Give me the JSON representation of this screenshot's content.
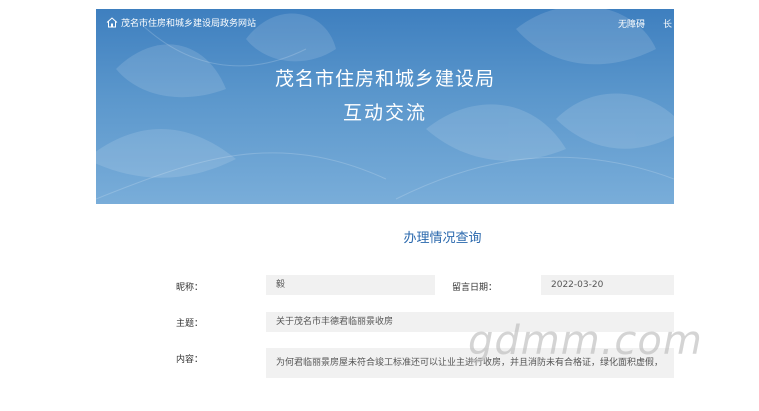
{
  "header": {
    "site_name": "茂名市住房和城乡建设局政务网站",
    "accessibility_link": "无障碍",
    "elder_link": "长",
    "title_line1": "茂名市住房和城乡建设局",
    "title_line2": "互动交流"
  },
  "section": {
    "title": "办理情况查询"
  },
  "form": {
    "nickname_label": "昵称：",
    "nickname_value": "毅",
    "date_label": "留言日期：",
    "date_value": "2022-03-20",
    "subject_label": "主题：",
    "subject_value": "关于茂名市丰德君临丽景收房",
    "content_label": "内容：",
    "content_value": "为何君临丽景房屋未符合竣工标准还可以让业主进行收房，并且消防未有合格证，绿化面积虚假，"
  },
  "watermark": "gdmm.com",
  "colors": {
    "banner_top": "#3e7fbf",
    "banner_bottom": "#79add9",
    "section_title": "#2a68ad",
    "field_bg": "#f1f1f1"
  }
}
